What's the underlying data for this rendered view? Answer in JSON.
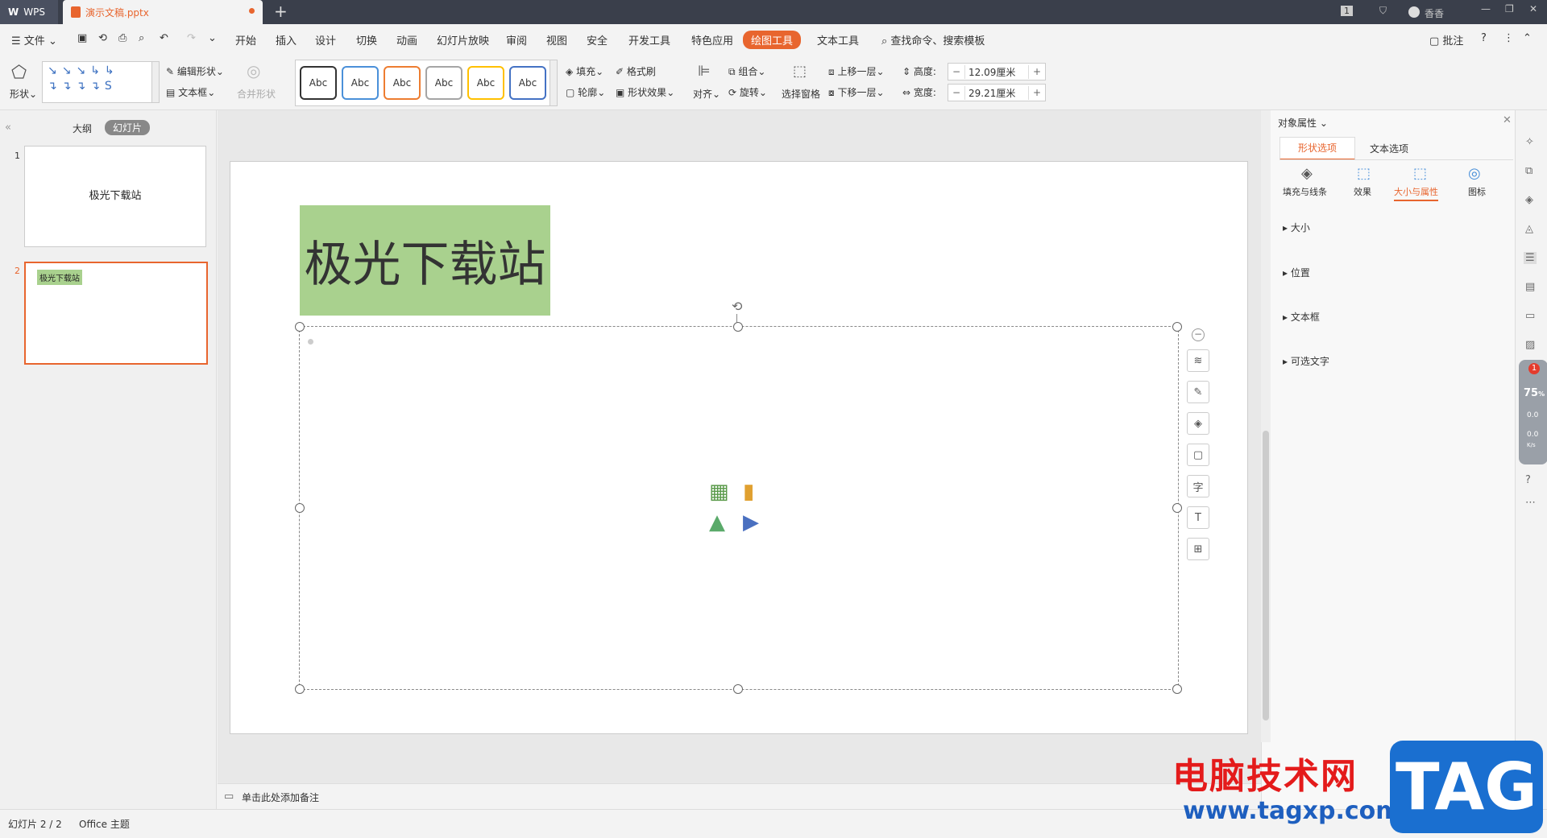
{
  "titlebar": {
    "app": "WPS",
    "doc_tab": "演示文稿.pptx",
    "new_tab": "+",
    "user": "香香",
    "badge": "1"
  },
  "menu": {
    "file": "文件",
    "items": [
      "开始",
      "插入",
      "设计",
      "切换",
      "动画",
      "幻灯片放映",
      "审阅",
      "视图",
      "安全",
      "开发工具",
      "特色应用"
    ],
    "active": "绘图工具",
    "text_tool": "文本工具",
    "search": "查找命令、搜索模板",
    "comment": "批注",
    "help": "?"
  },
  "ribbon": {
    "shape": "形状",
    "edit_shape": "编辑形状",
    "text_box": "文本框",
    "merge_shape": "合并形状",
    "styles": [
      "Abc",
      "Abc",
      "Abc",
      "Abc",
      "Abc",
      "Abc"
    ],
    "style_colors": [
      "#333333",
      "#4a90d9",
      "#ed7d31",
      "#a5a5a5",
      "#ffc000",
      "#4472c4"
    ],
    "fill": "填充",
    "format_brush": "格式刷",
    "outline": "轮廓",
    "shape_effect": "形状效果",
    "align": "对齐",
    "group": "组合",
    "rotate": "旋转",
    "selection_pane": "选择窗格",
    "bring_forward": "上移一层",
    "send_backward": "下移一层",
    "height_label": "高度:",
    "height_value": "12.09厘米",
    "width_label": "宽度:",
    "width_value": "29.21厘米"
  },
  "leftpanel": {
    "tab_outline": "大纲",
    "tab_slides": "幻灯片",
    "slide1_num": "1",
    "slide1_text": "极光下载站",
    "slide2_num": "2",
    "slide2_text": "极光下载站"
  },
  "slide": {
    "title": "极光下载站"
  },
  "notes": {
    "placeholder": "单击此处添加备注"
  },
  "rightpanel": {
    "title": "对象属性",
    "tab_shape": "形状选项",
    "tab_text": "文本选项",
    "sub_fill": "填充与线条",
    "sub_effect": "效果",
    "sub_size": "大小与属性",
    "sub_icon": "图标",
    "sections": [
      "大小",
      "位置",
      "文本框",
      "可选文字"
    ]
  },
  "status": {
    "slide_count": "幻灯片 2 / 2",
    "theme": "Office 主题"
  },
  "overlay": {
    "speed": "75",
    "speed_unit": "%",
    "net1": "0.0",
    "net2": "0.0",
    "net_unit": "K/s",
    "notif": "1"
  },
  "watermark": {
    "site": "电脑技术网",
    "url": "www.tagxp.com",
    "tag": "TAG"
  }
}
